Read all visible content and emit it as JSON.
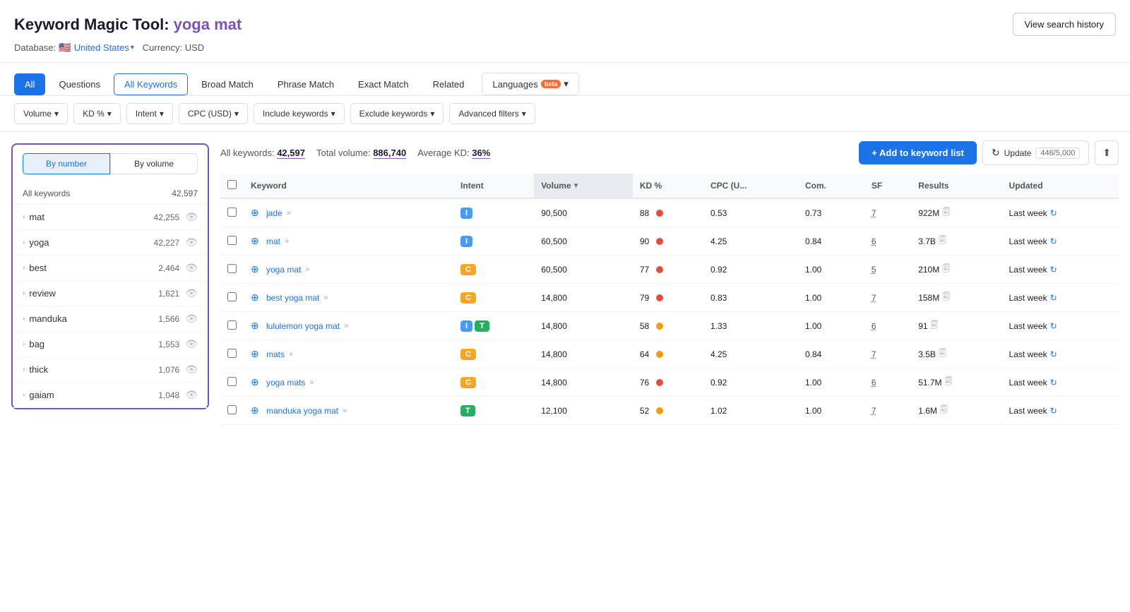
{
  "header": {
    "tool_label": "Keyword Magic Tool:",
    "query": "yoga mat",
    "view_history_label": "View search history",
    "database_label": "Database:",
    "database_value": "United States",
    "currency_label": "Currency: USD"
  },
  "tabs": [
    {
      "id": "all",
      "label": "All",
      "active": true,
      "bordered": false
    },
    {
      "id": "questions",
      "label": "Questions",
      "active": false
    },
    {
      "id": "all-keywords",
      "label": "All Keywords",
      "active": false,
      "bordered": true
    },
    {
      "id": "broad-match",
      "label": "Broad Match",
      "active": false
    },
    {
      "id": "phrase-match",
      "label": "Phrase Match",
      "active": false
    },
    {
      "id": "exact-match",
      "label": "Exact Match",
      "active": false
    },
    {
      "id": "related",
      "label": "Related",
      "active": false
    },
    {
      "id": "languages",
      "label": "Languages",
      "beta": true
    }
  ],
  "filters": [
    {
      "id": "volume",
      "label": "Volume ▾"
    },
    {
      "id": "kd",
      "label": "KD % ▾"
    },
    {
      "id": "intent",
      "label": "Intent ▾"
    },
    {
      "id": "cpc",
      "label": "CPC (USD) ▾"
    },
    {
      "id": "include-keywords",
      "label": "Include keywords ▾"
    },
    {
      "id": "exclude-keywords",
      "label": "Exclude keywords ▾"
    },
    {
      "id": "advanced-filters",
      "label": "Advanced filters ▾"
    }
  ],
  "sidebar": {
    "by_number_label": "By number",
    "by_volume_label": "By volume",
    "all_keywords_label": "All keywords",
    "all_keywords_count": "42,597",
    "items": [
      {
        "keyword": "mat",
        "count": "42,255"
      },
      {
        "keyword": "yoga",
        "count": "42,227"
      },
      {
        "keyword": "best",
        "count": "2,464"
      },
      {
        "keyword": "review",
        "count": "1,621"
      },
      {
        "keyword": "manduka",
        "count": "1,566"
      },
      {
        "keyword": "bag",
        "count": "1,553"
      },
      {
        "keyword": "thick",
        "count": "1,076"
      },
      {
        "keyword": "gaiam",
        "count": "1,048"
      }
    ]
  },
  "table_stats": {
    "all_keywords_label": "All keywords:",
    "all_keywords_count": "42,597",
    "total_volume_label": "Total volume:",
    "total_volume_value": "886,740",
    "avg_kd_label": "Average KD:",
    "avg_kd_value": "36%"
  },
  "actions": {
    "add_keyword_label": "+ Add to keyword list",
    "update_label": "Update",
    "update_count": "446/5,000"
  },
  "table": {
    "columns": [
      "",
      "Keyword",
      "Intent",
      "Volume",
      "KD %",
      "CPC (U...",
      "Com.",
      "SF",
      "Results",
      "Updated"
    ],
    "rows": [
      {
        "keyword": "jade",
        "intent": [
          "I"
        ],
        "volume": "90,500",
        "kd": "88",
        "kd_level": "red",
        "cpc": "0.53",
        "com": "0.73",
        "sf": "7",
        "results": "922M",
        "updated": "Last week"
      },
      {
        "keyword": "mat",
        "intent": [
          "I"
        ],
        "volume": "60,500",
        "kd": "90",
        "kd_level": "red",
        "cpc": "4.25",
        "com": "0.84",
        "sf": "6",
        "results": "3.7B",
        "updated": "Last week"
      },
      {
        "keyword": "yoga mat",
        "intent": [
          "C"
        ],
        "volume": "60,500",
        "kd": "77",
        "kd_level": "red",
        "cpc": "0.92",
        "com": "1.00",
        "sf": "5",
        "results": "210M",
        "updated": "Last week"
      },
      {
        "keyword": "best yoga mat",
        "intent": [
          "C"
        ],
        "volume": "14,800",
        "kd": "79",
        "kd_level": "red",
        "cpc": "0.83",
        "com": "1.00",
        "sf": "7",
        "results": "158M",
        "updated": "Last week"
      },
      {
        "keyword": "lululemon yoga mat",
        "intent": [
          "I",
          "T"
        ],
        "volume": "14,800",
        "kd": "58",
        "kd_level": "orange",
        "cpc": "1.33",
        "com": "1.00",
        "sf": "6",
        "results": "91",
        "updated": "Last week"
      },
      {
        "keyword": "mats",
        "intent": [
          "C"
        ],
        "volume": "14,800",
        "kd": "64",
        "kd_level": "orange",
        "cpc": "4.25",
        "com": "0.84",
        "sf": "7",
        "results": "3.5B",
        "updated": "Last week"
      },
      {
        "keyword": "yoga mats",
        "intent": [
          "C"
        ],
        "volume": "14,800",
        "kd": "76",
        "kd_level": "red",
        "cpc": "0.92",
        "com": "1.00",
        "sf": "6",
        "results": "51.7M",
        "updated": "Last week"
      },
      {
        "keyword": "manduka yoga mat",
        "intent": [
          "T"
        ],
        "volume": "12,100",
        "kd": "52",
        "kd_level": "orange",
        "cpc": "1.02",
        "com": "1.00",
        "sf": "7",
        "results": "1.6M",
        "updated": "Last week"
      }
    ]
  }
}
